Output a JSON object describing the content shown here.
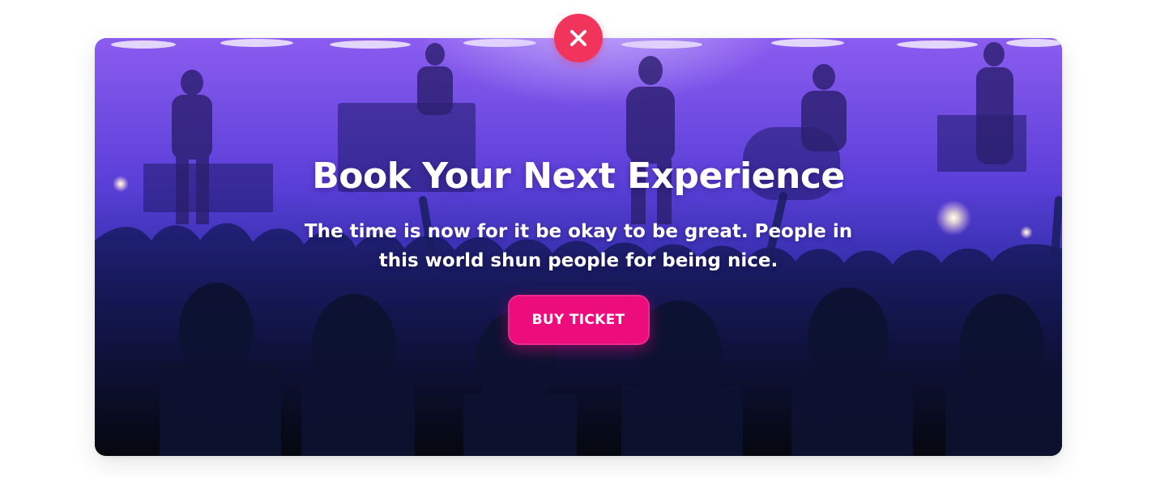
{
  "modal": {
    "title": "Book Your Next Experience",
    "subtitle": "The time is now for it be okay to be great. People in this world shun people for being nice.",
    "cta_label": "BUY TICKET",
    "close_icon": "close-icon",
    "background_image": "concert-crowd-stage-image"
  },
  "colors": {
    "cta": "#ec0c7b",
    "close": "#f0345c",
    "overlay_top": "#7a4df0",
    "overlay_bottom": "#0a0f1c"
  }
}
